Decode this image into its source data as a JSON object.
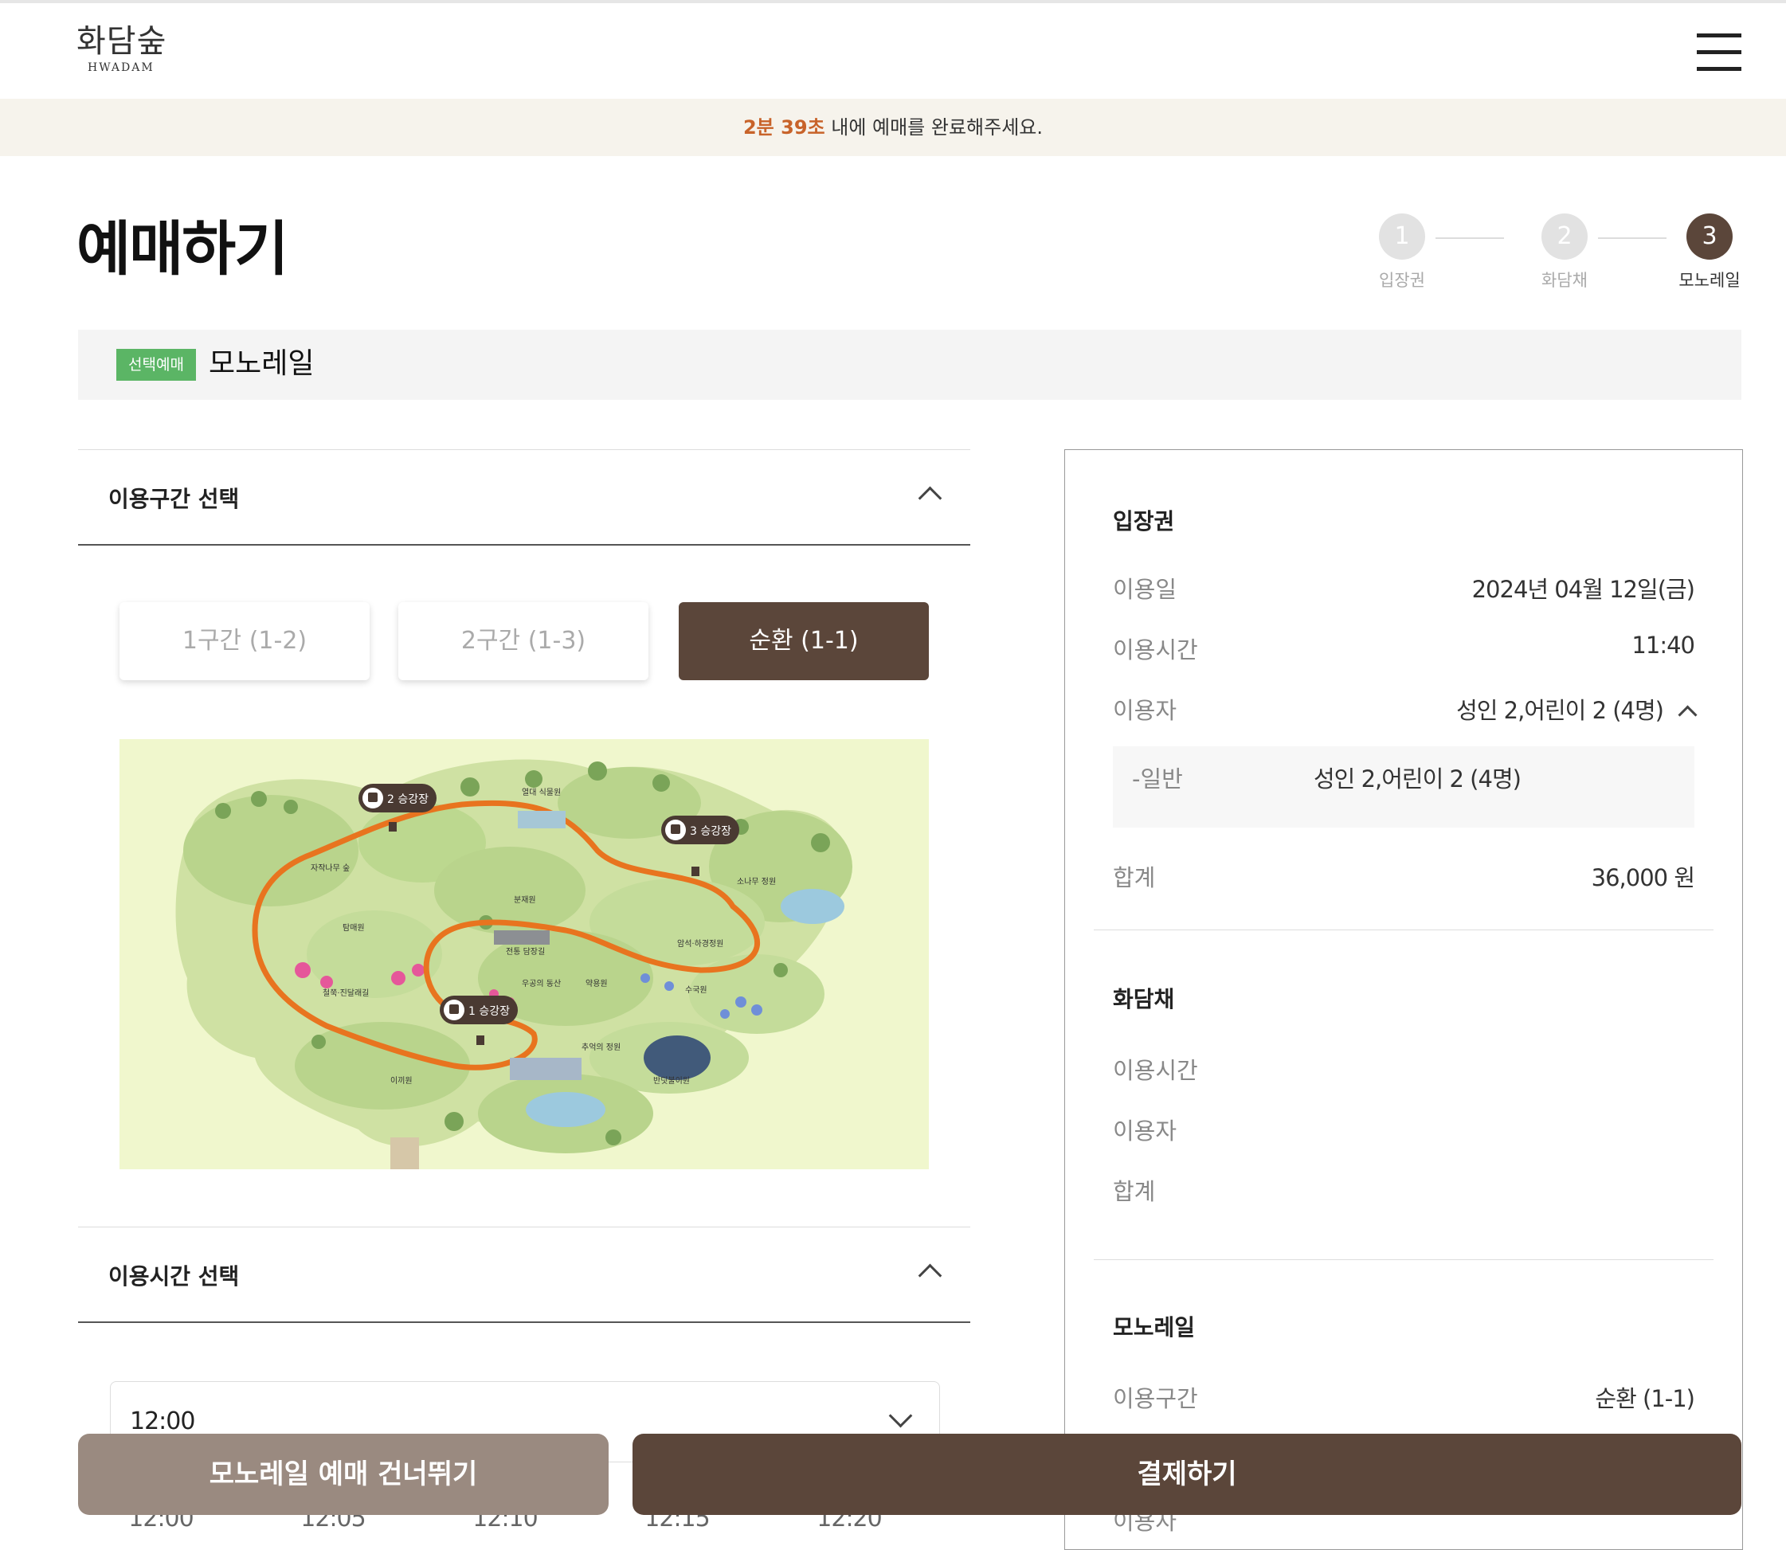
{
  "header": {
    "logo_ko": "화담숲",
    "logo_en": "HWADAM"
  },
  "timer": {
    "countdown": "2분 39초",
    "message": " 내에 예매를 완료해주세요."
  },
  "page_title": "예매하기",
  "steps": [
    {
      "num": "1",
      "label": "입장권",
      "active": false
    },
    {
      "num": "2",
      "label": "화담채",
      "active": false
    },
    {
      "num": "3",
      "label": "모노레일",
      "active": true
    }
  ],
  "section": {
    "badge": "선택예매",
    "title": "모노레일"
  },
  "route": {
    "heading": "이용구간 선택",
    "options": [
      "1구간 (1-2)",
      "2구간 (1-3)",
      "순환 (1-1)"
    ],
    "selected": "순환 (1-1)"
  },
  "map": {
    "labels": {
      "station1": "1 승강장",
      "station2": "2 승강장",
      "station3": "3 승강장",
      "birch": "자작나무 숲",
      "greenhouse": "열대 식물원",
      "pine": "소나무 정원",
      "bonsai": "분재원",
      "moss": "탐매원",
      "azalea": "철쭉·진달래길",
      "stream": "전통 담장길",
      "woogong": "우공의 동산",
      "herb": "약용원",
      "hydrangea": "수국원",
      "japanese": "암석·하경정원",
      "memory": "추억의 정원",
      "firefly": "반딧불이원",
      "rock": "이끼원"
    }
  },
  "time": {
    "heading": "이용시간 선택",
    "selected": "12:00",
    "chips": [
      "12:00",
      "12:05",
      "12:10",
      "12:15",
      "12:20"
    ]
  },
  "summary": {
    "ticket": {
      "title": "입장권",
      "date_label": "이용일",
      "date_value": "2024년 04월 12일(금)",
      "time_label": "이용시간",
      "time_value": "11:40",
      "users_label": "이용자",
      "users_value": "성인 2,어린이 2 (4명)",
      "sub_label": "-일반",
      "sub_value": "성인 2,어린이 2 (4명)",
      "total_label": "합계",
      "total_value": "36,000 원"
    },
    "hwadamchae": {
      "title": "화담채",
      "time_label": "이용시간",
      "users_label": "이용자",
      "total_label": "합계"
    },
    "monorail": {
      "title": "모노레일",
      "route_label": "이용구간",
      "route_value": "순환 (1-1)",
      "users_label": "이용자"
    }
  },
  "buttons": {
    "skip": "모노레일 예매 건너뛰기",
    "pay": "결제하기"
  },
  "colors": {
    "brand_brown": "#5b463a",
    "skip_gray": "#9a8a80",
    "badge_green": "#5bb565",
    "timer_orange": "#c8632a",
    "route_orange": "#e8741f",
    "map_bg": "#f0f7cd"
  }
}
